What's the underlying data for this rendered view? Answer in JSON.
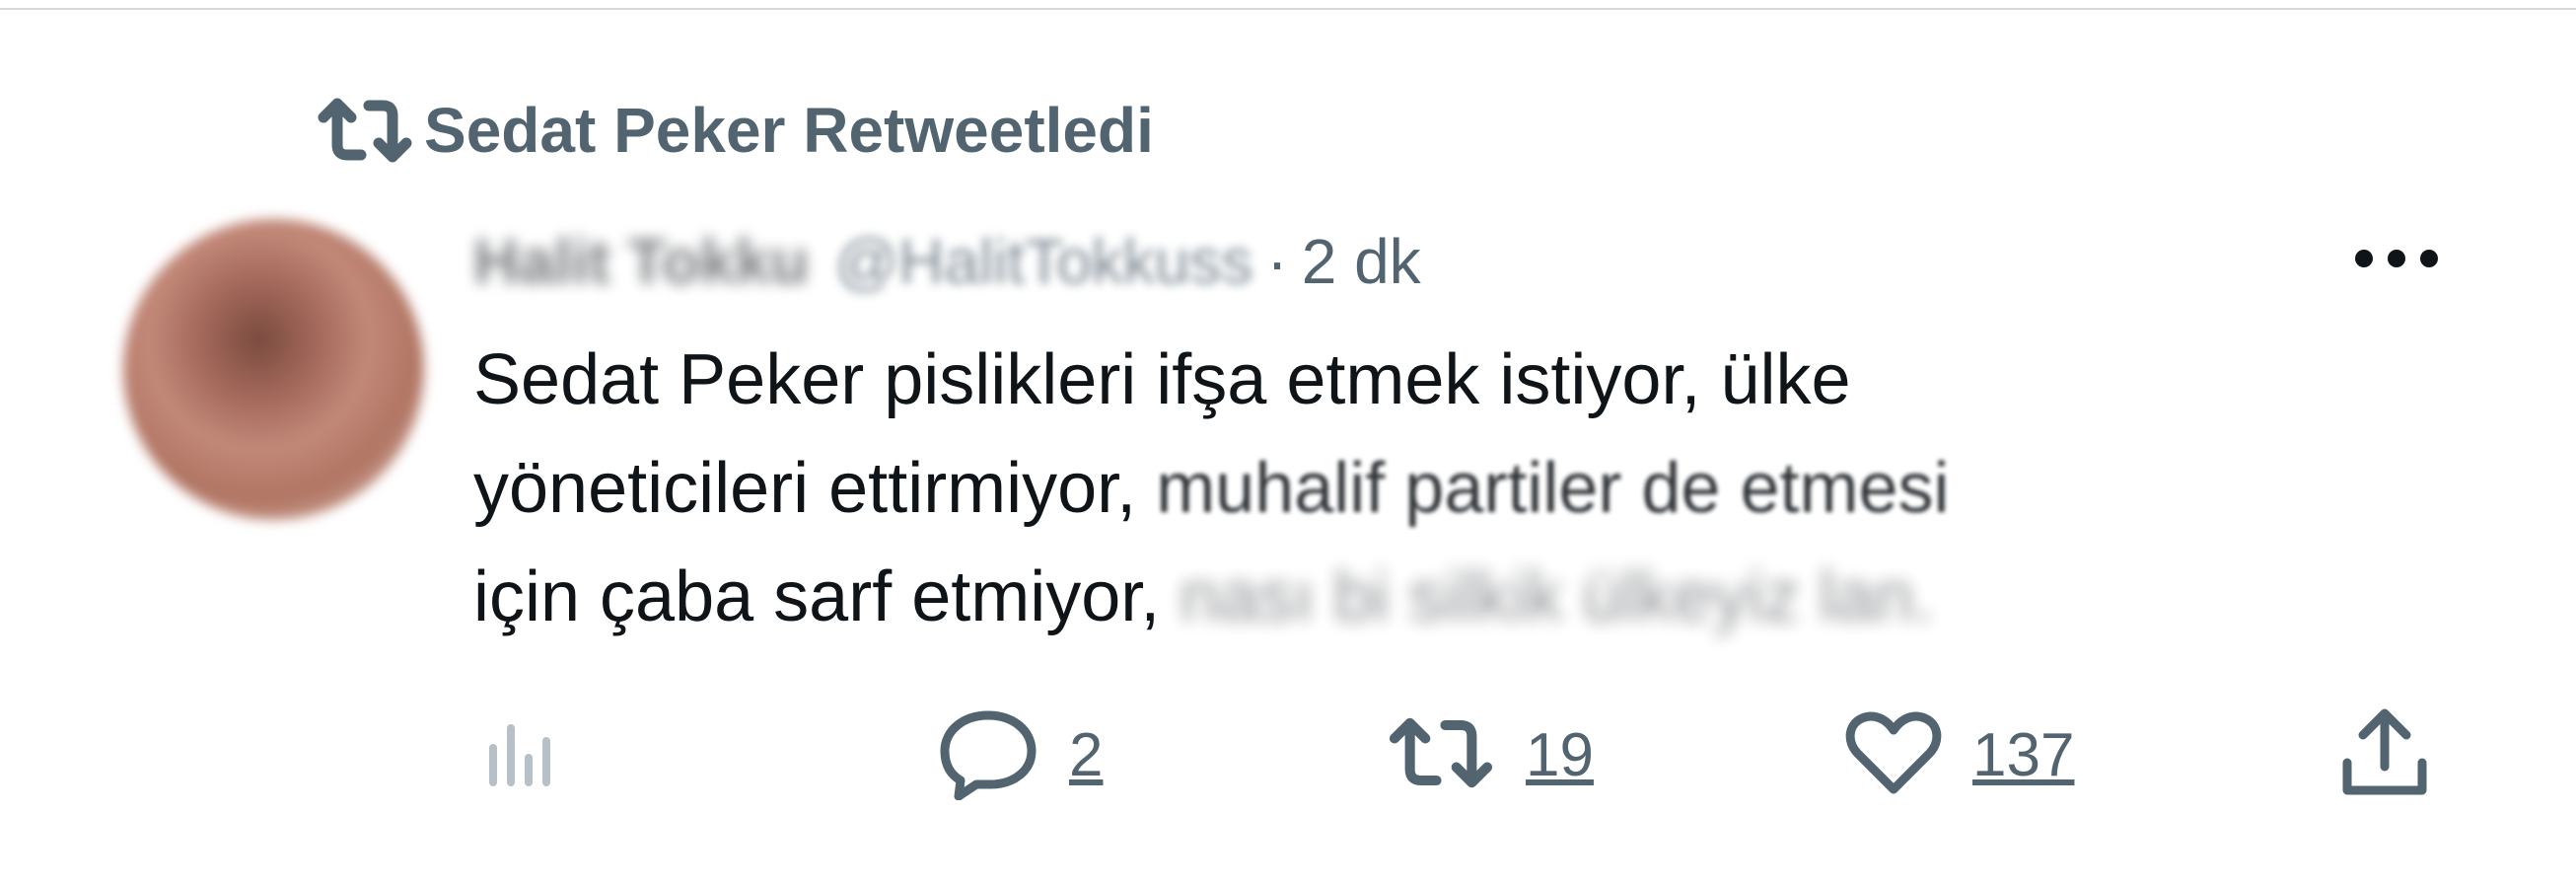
{
  "retweet_context": {
    "label": "Sedat Peker Retweetledi",
    "icon": "retweet-icon"
  },
  "tweet": {
    "author_name": "Halit Tokku",
    "author_handle": "@HalitTokkuss",
    "separator": "·",
    "timestamp": "2 dk",
    "text_lines": [
      "Sedat Peker pislikleri ifşa etmek istiyor, ülke",
      "yöneticileri ettirmiyor, muhalif partiler de etmesi",
      "için çaba sarf etmiyor,"
    ],
    "line2_part_a": "yöneticileri ettirmiyor, ",
    "line2_part_b": "muhalif partiler de etmesi",
    "text_blurred_tail": "nası bi silkik ülkeyiz lan."
  },
  "actions": {
    "views_icon": "views-icon",
    "reply_count": "2",
    "retweet_count": "19",
    "like_count": "137",
    "share_icon": "share-icon"
  },
  "colors": {
    "text_primary": "#0f1419",
    "text_secondary": "#536471",
    "divider": "#d6d9dc"
  }
}
